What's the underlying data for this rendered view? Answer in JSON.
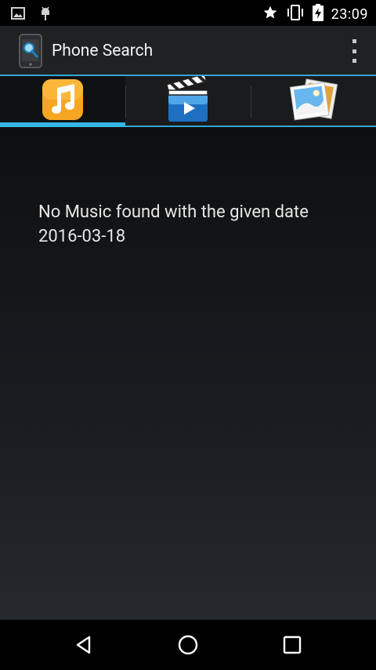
{
  "status_bar": {
    "time": "23:09",
    "left_icons": [
      "image-notification-icon",
      "android-debug-icon"
    ],
    "right_icons": [
      "star-icon",
      "vibrate-icon",
      "battery-charging-icon"
    ]
  },
  "action_bar": {
    "title": "Phone Search",
    "app_icon": "phone-search-app-icon",
    "overflow_icon": "overflow-menu-icon"
  },
  "tabs": [
    {
      "id": "music",
      "icon": "music-note-icon",
      "active": true
    },
    {
      "id": "video",
      "icon": "video-clapper-icon",
      "active": false
    },
    {
      "id": "photos",
      "icon": "photos-icon",
      "active": false
    }
  ],
  "content": {
    "empty_message": "No Music found with the given date 2016-03-18"
  },
  "nav_bar": {
    "buttons": [
      "back-icon",
      "home-icon",
      "recents-icon"
    ]
  },
  "colors": {
    "accent": "#34b5e5",
    "action_bar_bg": "#1f2123",
    "music_icon": "#f5a623"
  }
}
